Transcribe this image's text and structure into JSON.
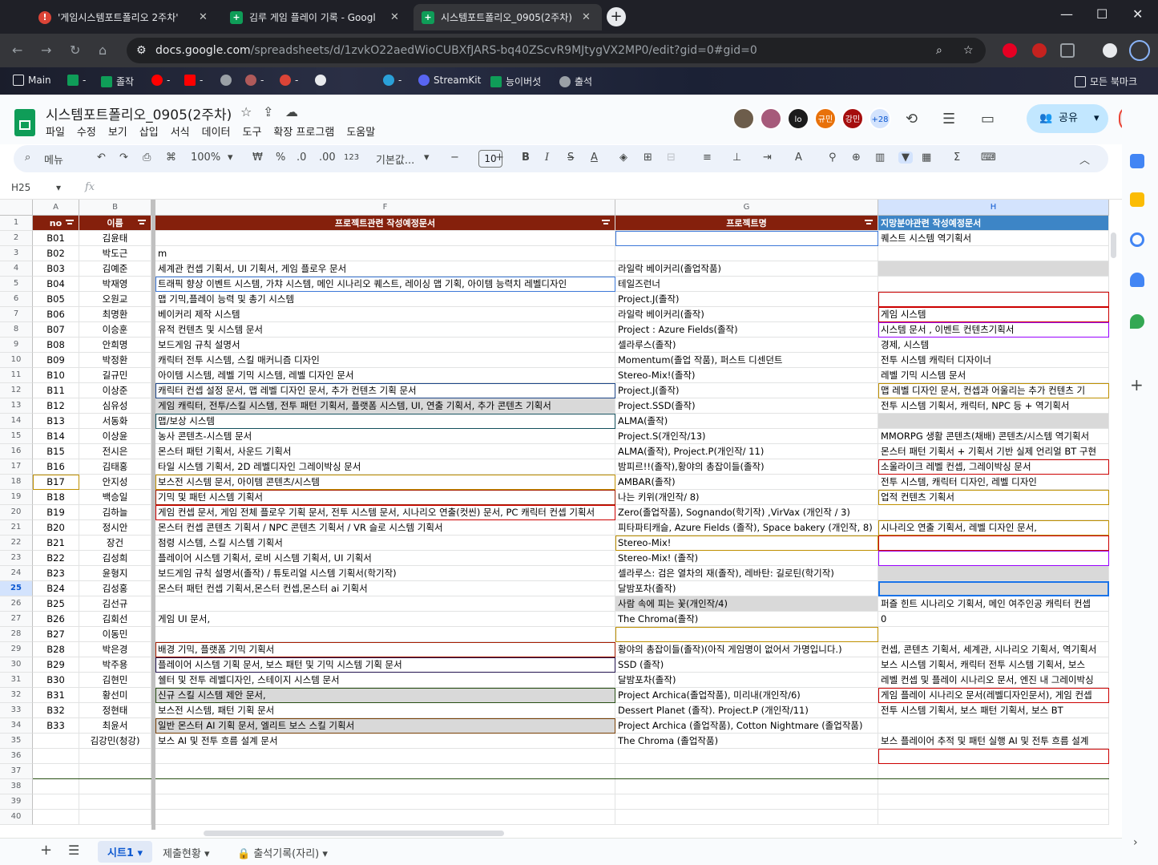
{
  "browser": {
    "tabs": [
      {
        "label": "'게임시스템포트폴리오 2주차'",
        "active": false
      },
      {
        "label": "김루 게임 플레이 기록 - Googl",
        "active": false
      },
      {
        "label": "시스템포트폴리오_0905(2주차)",
        "active": true
      }
    ],
    "url_host": "docs.google.com",
    "url_path": "/spreadsheets/d/1zvkO22aedWioCUBXfJARS-bq40ZScvR9MJtygVX2MP0/edit?gid=0#gid=0",
    "bookmarks": [
      "Main",
      "",
      "졸작",
      "",
      "",
      "",
      "",
      "",
      "",
      "StreamKit",
      "능이버섯",
      "출석"
    ],
    "bookmarks_all": "모든 북마크"
  },
  "doc": {
    "title": "시스템포트폴리오_0905(2주차)",
    "menus": [
      "파일",
      "수정",
      "보기",
      "삽입",
      "서식",
      "데이터",
      "도구",
      "확장 프로그램",
      "도움말"
    ],
    "collaborators": [
      {
        "label": "",
        "color": "#6d5d4b"
      },
      {
        "label": "",
        "color": "#a65a7a"
      },
      {
        "label": "lo",
        "color": "#1b1b1b"
      },
      {
        "label": "규민",
        "color": "#e8710a"
      },
      {
        "label": "강민",
        "color": "#a50e0e"
      },
      {
        "label": "+28",
        "color": "#d3e3fd"
      }
    ],
    "share_label": "공유"
  },
  "toolbar": {
    "menu_search": "메뉴",
    "zoom": "100%",
    "currency": "₩",
    "percent": "%",
    "dec_dec": ".0",
    "dec_inc": ".00",
    "format123": "123",
    "font": "기본값...",
    "font_size": "10"
  },
  "formula_bar": {
    "cell_ref": "H25",
    "fx": "fx"
  },
  "columns": {
    "letters": [
      "A",
      "B",
      "F",
      "G",
      "H"
    ],
    "headers": {
      "A": "no",
      "B": "이름",
      "F": "프로젝트관련 작성예정문서",
      "G": "프로젝트명",
      "H": "지망분야관련 작성예정문서"
    }
  },
  "rows": [
    {
      "n": "2",
      "A": "B01",
      "B": "김윤태",
      "F": "",
      "G": "",
      "H": "퀘스트 시스템 역기획서"
    },
    {
      "n": "3",
      "A": "B02",
      "B": "박도근",
      "F": "m",
      "G": "",
      "H": ""
    },
    {
      "n": "4",
      "A": "B03",
      "B": "김예준",
      "F": "세계관 컨셉 기획서, UI 기획서, 게임 플로우 문서",
      "G": "라일락 베이커리(졸업작품)",
      "H": ""
    },
    {
      "n": "5",
      "A": "B04",
      "B": "박재영",
      "F": "트래픽 향상 이벤트 시스템, 가챠 시스템, 메인 시나리오 퀘스트, 레이싱 맵 기획, 아이템 능력치 레벨디자인",
      "G": "테일즈런너",
      "H": ""
    },
    {
      "n": "6",
      "A": "B05",
      "B": "오원교",
      "F": "맵 기믹,플레이 능력 및 총기 시스템",
      "G": "Project.J(졸작)",
      "H": ""
    },
    {
      "n": "7",
      "A": "B06",
      "B": "최명환",
      "F": "베이커리 제작 시스템",
      "G": "라일락 베이커리(졸작)",
      "H": "게임 시스템"
    },
    {
      "n": "8",
      "A": "B07",
      "B": "이승훈",
      "F": "유적 컨텐츠 및 시스템 문서",
      "G": "Project : Azure Fields(졸작)",
      "H": "시스템 문서 , 이벤트 컨텐츠기획서"
    },
    {
      "n": "9",
      "A": "B08",
      "B": "안희명",
      "F": "보드게임 규칙 설명서",
      "G": "셀라루스(졸작)",
      "H": "경제, 시스템"
    },
    {
      "n": "10",
      "A": "B09",
      "B": "박정환",
      "F": "캐릭터 전투 시스템, 스킬 매커니즘 디자인",
      "G": "Momentum(졸업 작품), 퍼스트 디센던트",
      "H": "전투 시스템 캐릭터 디자이너"
    },
    {
      "n": "11",
      "A": "B10",
      "B": "길규민",
      "F": "아이템 시스템, 레벨 기믹 시스템, 레벨 디자인 문서",
      "G": "Stereo-Mix!(졸작)",
      "H": "레벨 기믹 시스템 문서"
    },
    {
      "n": "12",
      "A": "B11",
      "B": "이상준",
      "F": "캐릭터 컨셉 설정 문서, 맵 레벨 디자인 문서, 추가 컨텐츠 기획 문서",
      "G": "Project.J(졸작)",
      "H": "맵 레벨 디자인 문서, 컨셉과 어울리는 추가 컨텐츠 기"
    },
    {
      "n": "13",
      "A": "B12",
      "B": "심유성",
      "F": "게임 캐릭터, 전투/스킬 시스템, 전투 패턴 기획서, 플랫폼 시스템, UI, 연출 기획서, 추가 콘텐츠 기획서",
      "G": "Project.SSD(졸작)",
      "H": "전투 시스템 기획서, 캐릭터, NPC 등 + 역기획서"
    },
    {
      "n": "14",
      "A": "B13",
      "B": "서동화",
      "F": "맵/보상 시스템",
      "G": "ALMA(졸작)",
      "H": ""
    },
    {
      "n": "15",
      "A": "B14",
      "B": "이상윤",
      "F": "농사 콘텐츠-시스템 문서",
      "G": "Project.S(개인작/13)",
      "H": "MMORPG 생활 콘텐츠(채배) 콘텐츠/시스템 역기획서"
    },
    {
      "n": "16",
      "A": "B15",
      "B": "전시은",
      "F": "몬스터 패턴 기획서, 사운드 기획서",
      "G": "ALMA(졸작), Project.P(개인작/ 11)",
      "H": "몬스터 패턴 기획서 + 기획서 기반 실제 언리얼 BT 구현"
    },
    {
      "n": "17",
      "A": "B16",
      "B": "김태홍",
      "F": "타일 시스템 기획서, 2D 레벨디자인 그레이박싱 문서",
      "G": "밤피르!!(졸작),황야의 총잡이들(졸작)",
      "H": "소울라이크 레벨 컨셉, 그레이박싱 문서"
    },
    {
      "n": "18",
      "A": "B17",
      "B": "안지성",
      "F": "보스전 시스템 문서, 아이템 콘텐츠/시스템",
      "G": "AMBAR(졸작)",
      "H": "전투 시스템, 캐릭터 디자인, 레벨 디자인"
    },
    {
      "n": "19",
      "A": "B18",
      "B": "백승일",
      "F": "기믹 및 패턴 시스템 기획서",
      "G": "나는 키위(개인작/ 8)",
      "H": "업적 컨텐츠 기획서"
    },
    {
      "n": "20",
      "A": "B19",
      "B": "김하늘",
      "F": "게임 컨셉 문서, 게임 전체 플로우 기획 문서, 전투 시스템 문서, 시나리오 연출(컷씬) 문서, PC 캐릭터 컨셉 기획서",
      "G": "Zero(졸업작품), Sognando(학기작) ,VirVax (개인작 / 3)",
      "H": ""
    },
    {
      "n": "21",
      "A": "B20",
      "B": "정시안",
      "F": "몬스터 컨셉 콘텐츠 기획서 / NPC 콘텐츠 기획서 / VR 슬로 시스템 기획서",
      "G": "피타파티캐슬, Azure Fields (졸작), Space bakery (개인작, 8)",
      "H": "시나리오 연출 기획서, 레벨 디자인 문서,"
    },
    {
      "n": "22",
      "A": "B21",
      "B": "장건",
      "F": "점령 시스템, 스킬 시스템 기획서",
      "G": "Stereo-Mix!",
      "H": ""
    },
    {
      "n": "23",
      "A": "B22",
      "B": "김성희",
      "F": "플레이어 시스템 기획서, 로비 시스템 기획서,  UI 기획서",
      "G": "Stereo-Mix! (졸작)",
      "H": ""
    },
    {
      "n": "24",
      "A": "B23",
      "B": "윤형지",
      "F": "보드게임 규칙 설명서(졸작) / 튜토리얼 시스템 기획서(학기작)",
      "G": "셀라루스: 검은 열차의 재(졸작), 레바탄: 길로틴(학기작)",
      "H": ""
    },
    {
      "n": "25",
      "A": "B24",
      "B": "김성홍",
      "F": "몬스터 패턴 컨셉 기획서,몬스터 컨셉,몬스터 ai 기획서",
      "G": "달밤포차(졸작)",
      "H": ""
    },
    {
      "n": "26",
      "A": "B25",
      "B": "김선규",
      "F": "",
      "G": "사람 속에 피는 꽃(개인작/4)",
      "H": "퍼즐 힌트 시나리오 기획서, 메인 여주인공 캐릭터 컨셉"
    },
    {
      "n": "27",
      "A": "B26",
      "B": "김회선",
      "F": "게임 UI 문서,",
      "G": "The Chroma(졸작)",
      "H": "0"
    },
    {
      "n": "28",
      "A": "B27",
      "B": "이동민",
      "F": "",
      "G": "",
      "H": ""
    },
    {
      "n": "29",
      "A": "B28",
      "B": "박은경",
      "F": "배경 기믹, 플랫폼 기믹 기획서",
      "G": "황야의 총잡이들(졸작)(아직 게임명이 없어서 가명입니다.)",
      "H": "컨셉, 콘텐츠 기획서, 세계관, 시나리오 기획서, 역기획서"
    },
    {
      "n": "30",
      "A": "B29",
      "B": "박주용",
      "F": "플레이어 시스템 기획 문서, 보스 패턴 및 기믹 시스템 기획 문서",
      "G": "SSD (졸작)",
      "H": "보스 시스템 기획서, 캐릭터 전투 시스템 기획서, 보스"
    },
    {
      "n": "31",
      "A": "B30",
      "B": "김현민",
      "F": "쉘터 및 전투 레벨디자인, 스테이지 시스템 문서",
      "G": "달밤포차(졸작)",
      "H": "레벨 컨셉 및 플레이 시나리오 문서, 엔진 내 그레이박싱"
    },
    {
      "n": "32",
      "A": "B31",
      "B": "황선미",
      "F": "신규 스킬 시스템 제안 문서,",
      "G": "Project Archica(졸업작품), 미리내(개인작/6)",
      "H": "게임 플레이 시나리오 문서(레벨디자인문서), 게임 컨셉"
    },
    {
      "n": "33",
      "A": "B32",
      "B": "정현태",
      "F": "보스전 시스템, 패턴 기획 문서",
      "G": "Dessert Planet (졸작). Project.P (개인작/11)",
      "H": "전투 시스템 기획서, 보스 패턴 기획서, 보스 BT"
    },
    {
      "n": "34",
      "A": "B33",
      "B": "최윤서",
      "F": "일반 몬스터 AI 기획 문서, 엘리트 보스 스킬 기획서",
      "G": "Project Archica (졸업작품), Cotton Nightmare (졸업작품)",
      "H": ""
    },
    {
      "n": "35",
      "A": "",
      "B": "김강민(청강)",
      "F": "보스 AI 및 전투 흐름 설계 문서",
      "G": "The Chroma (졸업작품)",
      "H": "보스 플레이어 추적 및 패턴 실행 AI 및 전투 흐름 설계"
    },
    {
      "n": "36",
      "A": "",
      "B": "",
      "F": "",
      "G": "",
      "H": ""
    },
    {
      "n": "37",
      "A": "",
      "B": "",
      "F": "",
      "G": "",
      "H": ""
    },
    {
      "n": "38",
      "A": "",
      "B": "",
      "F": "",
      "G": "",
      "H": ""
    },
    {
      "n": "39",
      "A": "",
      "B": "",
      "F": "",
      "G": "",
      "H": ""
    },
    {
      "n": "40",
      "A": "",
      "B": "",
      "F": "",
      "G": "",
      "H": ""
    }
  ],
  "sheet_tabs": [
    "시트1",
    "제출현황",
    "출석기록(자리)"
  ],
  "colors": {
    "header_dark_red": "#85200c",
    "header_blue": "#3d85c6",
    "sheets_green": "#0f9d58",
    "share_blue": "#c2e7ff"
  }
}
